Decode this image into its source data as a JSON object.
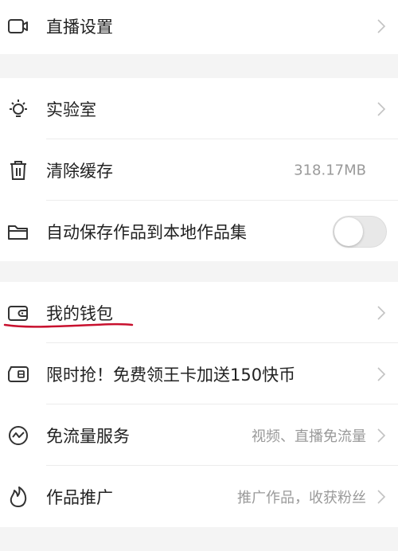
{
  "settings": {
    "live": {
      "label": "直播设置",
      "icon": "video-camera-icon"
    },
    "lab": {
      "label": "实验室",
      "icon": "lightbulb-icon"
    },
    "cache": {
      "label": "清除缓存",
      "value": "318.17MB",
      "icon": "trash-icon"
    },
    "autosave": {
      "label": "自动保存作品到本地作品集",
      "enabled": false,
      "icon": "folder-icon"
    },
    "wallet": {
      "label": "我的钱包",
      "icon": "wallet-icon"
    },
    "flash": {
      "label": "限时抢！免费领王卡加送150快币",
      "icon": "sim-card-icon"
    },
    "free_data": {
      "label": "免流量服务",
      "value": "视频、直播免流量",
      "icon": "data-wave-icon"
    },
    "promote": {
      "label": "作品推广",
      "value": "推广作品，收获粉丝",
      "icon": "flame-icon"
    }
  },
  "colors": {
    "background": "#f4f4f4",
    "row_bg": "#ffffff",
    "text": "#222222",
    "secondary": "#9a9a9a",
    "annotation": "#c8102e"
  }
}
